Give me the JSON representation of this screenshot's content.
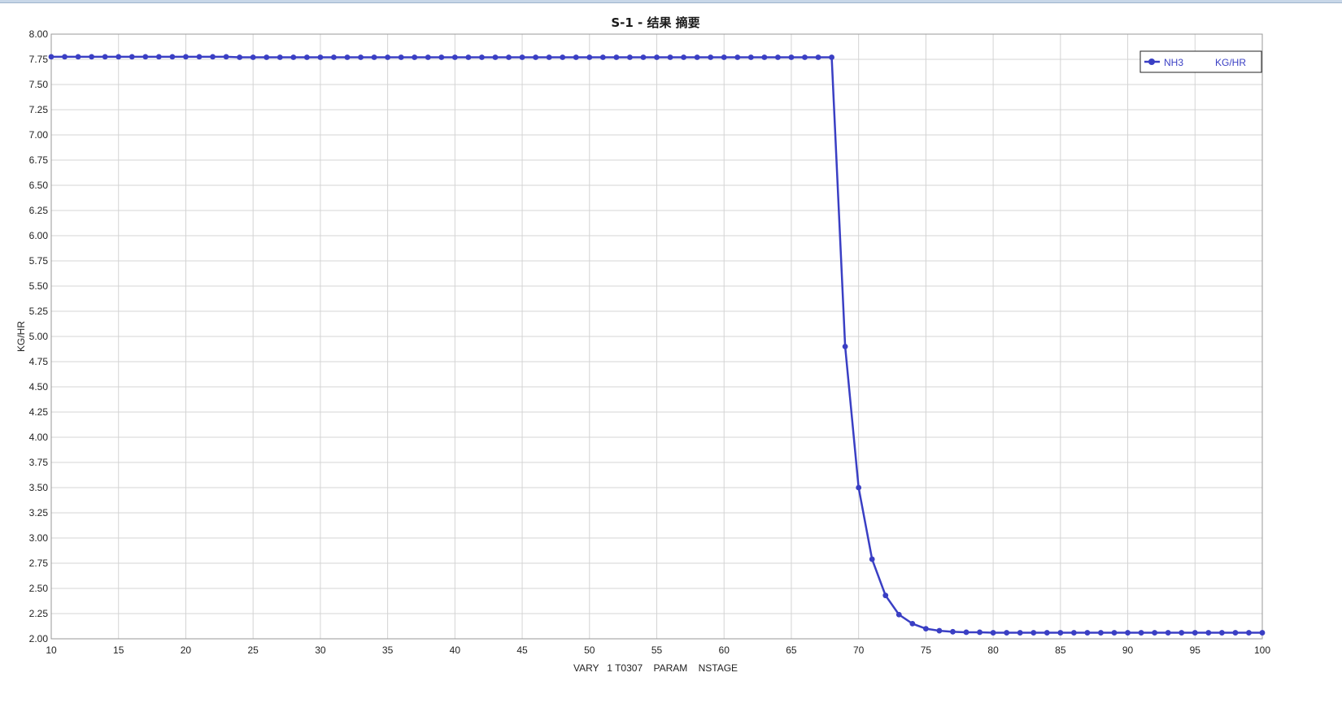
{
  "chart_data": {
    "type": "line",
    "title": "S-1 - 结果 摘要",
    "xlabel": "VARY   1 T0307    PARAM    NSTAGE",
    "ylabel": "KG/HR",
    "xlim": [
      10,
      100
    ],
    "ylim": [
      2.0,
      8.0
    ],
    "x_ticks": [
      "10",
      "15",
      "20",
      "25",
      "30",
      "35",
      "40",
      "45",
      "50",
      "55",
      "60",
      "65",
      "70",
      "75",
      "80",
      "85",
      "90",
      "95",
      "100"
    ],
    "y_ticks": [
      "2.00",
      "2.25",
      "2.50",
      "2.75",
      "3.00",
      "3.25",
      "3.50",
      "3.75",
      "4.00",
      "4.25",
      "4.50",
      "4.75",
      "5.00",
      "5.25",
      "5.50",
      "5.75",
      "6.00",
      "6.25",
      "6.50",
      "6.75",
      "7.00",
      "7.25",
      "7.50",
      "7.75",
      "8.00"
    ],
    "grid": true,
    "legend_position": "top-right",
    "series": [
      {
        "name": "NH3",
        "unit": "KG/HR",
        "color": "#3a3fc4",
        "x": [
          10,
          11,
          12,
          13,
          14,
          15,
          16,
          17,
          18,
          19,
          20,
          21,
          22,
          23,
          24,
          25,
          26,
          27,
          28,
          29,
          30,
          31,
          32,
          33,
          34,
          35,
          36,
          37,
          38,
          39,
          40,
          41,
          42,
          43,
          44,
          45,
          46,
          47,
          48,
          49,
          50,
          51,
          52,
          53,
          54,
          55,
          56,
          57,
          58,
          59,
          60,
          61,
          62,
          63,
          64,
          65,
          66,
          67,
          68,
          69,
          70,
          71,
          72,
          73,
          74,
          75,
          76,
          77,
          78,
          79,
          80,
          81,
          82,
          83,
          84,
          85,
          86,
          87,
          88,
          89,
          90,
          91,
          92,
          93,
          94,
          95,
          96,
          97,
          98,
          99,
          100
        ],
        "values": [
          7.775,
          7.775,
          7.775,
          7.775,
          7.775,
          7.775,
          7.775,
          7.775,
          7.775,
          7.775,
          7.775,
          7.775,
          7.775,
          7.775,
          7.77,
          7.77,
          7.77,
          7.77,
          7.77,
          7.77,
          7.77,
          7.77,
          7.77,
          7.77,
          7.77,
          7.77,
          7.77,
          7.77,
          7.77,
          7.77,
          7.77,
          7.77,
          7.77,
          7.77,
          7.77,
          7.77,
          7.77,
          7.77,
          7.77,
          7.77,
          7.77,
          7.77,
          7.77,
          7.77,
          7.77,
          7.77,
          7.77,
          7.77,
          7.77,
          7.77,
          7.77,
          7.77,
          7.77,
          7.77,
          7.77,
          7.77,
          7.77,
          7.77,
          7.77,
          4.9,
          3.5,
          2.79,
          2.43,
          2.24,
          2.15,
          2.1,
          2.08,
          2.07,
          2.065,
          2.065,
          2.06,
          2.06,
          2.06,
          2.06,
          2.06,
          2.06,
          2.06,
          2.06,
          2.06,
          2.06,
          2.06,
          2.06,
          2.06,
          2.06,
          2.06,
          2.06,
          2.06,
          2.06,
          2.06,
          2.06,
          2.06
        ]
      }
    ]
  }
}
